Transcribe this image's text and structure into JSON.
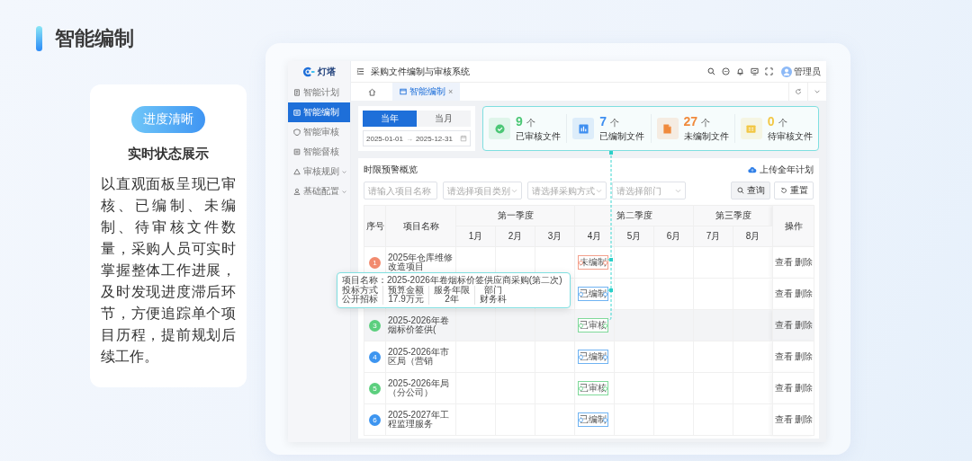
{
  "page": {
    "title": "智能编制"
  },
  "feature_card": {
    "badge": "进度清晰",
    "title": "实时状态展示",
    "description": "以直观面板呈现已审核、已编制、未编制、待审核文件数量，采购人员可实时掌握整体工作进展，及时发现进度滞后环节，方便追踪单个项目历程，提前规划后续工作。"
  },
  "app": {
    "logo": "灯塔",
    "title": "采购文件编制与审核系统",
    "user": "管理员",
    "sidebar": [
      {
        "label": "智能计划",
        "selected": false,
        "has_submenu": false
      },
      {
        "label": "智能编制",
        "selected": true,
        "has_submenu": false
      },
      {
        "label": "智能审核",
        "selected": false,
        "has_submenu": false
      },
      {
        "label": "智能督核",
        "selected": false,
        "has_submenu": false
      },
      {
        "label": "审核规则",
        "selected": false,
        "has_submenu": true
      },
      {
        "label": "基础配置",
        "selected": false,
        "has_submenu": true
      }
    ],
    "tabs": [
      {
        "kind": "home",
        "selected": false
      },
      {
        "kind": "page",
        "label": "智能编制",
        "close": "×",
        "selected": true
      }
    ],
    "period_tabs": [
      {
        "label": "当年",
        "selected": true
      },
      {
        "label": "当月",
        "selected": false
      }
    ],
    "date_range": {
      "start": "2025-01-01",
      "separator": "→",
      "end": "2025-12-31"
    },
    "stats": [
      {
        "value": "9",
        "unit": "个",
        "label": "已审核文件",
        "color": "#4cc776"
      },
      {
        "value": "7",
        "unit": "个",
        "label": "已编制文件",
        "color": "#3d8ef0"
      },
      {
        "value": "27",
        "unit": "个",
        "label": "未编制文件",
        "color": "#f08a3c"
      },
      {
        "value": "0",
        "unit": "个",
        "label": "待审核文件",
        "color": "#f2c744"
      }
    ],
    "section": {
      "title": "时限预警概览",
      "upload": "上传全年计划"
    },
    "filters": [
      {
        "kind": "input",
        "placeholder": "请输入项目名称"
      },
      {
        "kind": "select",
        "placeholder": "请选择项目类别"
      },
      {
        "kind": "select",
        "placeholder": "请选择采购方式"
      },
      {
        "kind": "select",
        "placeholder": "请选择部门"
      }
    ],
    "buttons": [
      {
        "kind": "search",
        "label": "查询"
      },
      {
        "kind": "reset",
        "label": "重置"
      }
    ],
    "table": {
      "index_header": "序号",
      "name_header": "项目名称",
      "actions_header": "操作",
      "quarters": [
        {
          "label": "第一季度",
          "months": [
            "1月",
            "2月",
            "3月"
          ]
        },
        {
          "label": "第二季度",
          "months": [
            "4月",
            "5月",
            "6月"
          ]
        },
        {
          "label": "第三季度",
          "months": [
            "7月",
            "8月"
          ]
        }
      ],
      "rows": [
        {
          "index": "1",
          "color": "#f28b6f",
          "name": "2025年仓库维修改造项目",
          "selected": false,
          "status": {
            "label": "未编制",
            "kind": "unedited"
          },
          "actions": [
            "查看",
            "删除"
          ]
        },
        {
          "selected": false,
          "status": {
            "label": "已编制",
            "kind": "edited"
          },
          "actions": [
            "查看",
            "删除"
          ]
        },
        {
          "index": "3",
          "color": "#5ccf7e",
          "name": "2025-2026年卷烟标价签供(",
          "selected": true,
          "status": {
            "label": "已审核",
            "kind": "reviewed"
          },
          "actions": [
            "查看",
            "删除"
          ]
        },
        {
          "index": "4",
          "color": "#3d95f0",
          "name": "2025-2026年市区局（营销",
          "selected": false,
          "status": {
            "label": "已编制",
            "kind": "edited"
          },
          "actions": [
            "查看",
            "删除"
          ]
        },
        {
          "index": "5",
          "color": "#5ccf7e",
          "name": "2025-2026年局（分公司）",
          "selected": false,
          "status": {
            "label": "已审核",
            "kind": "reviewed"
          },
          "actions": [
            "查看",
            "删除"
          ]
        },
        {
          "index": "6",
          "color": "#3d95f0",
          "name": "2025-2027年工程监理服务",
          "selected": false,
          "status": {
            "label": "已编制",
            "kind": "edited"
          },
          "actions": [
            "查看",
            "删除"
          ]
        }
      ]
    },
    "tooltip": {
      "title_label": "项目名称：",
      "title": "2025-2026年卷烟标价签供应商采购(第二次)",
      "fields": [
        {
          "label": "投标方式",
          "value": "公开招标"
        },
        {
          "label": "预算金额",
          "value": "17.9万元"
        },
        {
          "label": "服务年限",
          "value": "2年"
        },
        {
          "label": "部门",
          "value": "财务科"
        }
      ]
    }
  }
}
